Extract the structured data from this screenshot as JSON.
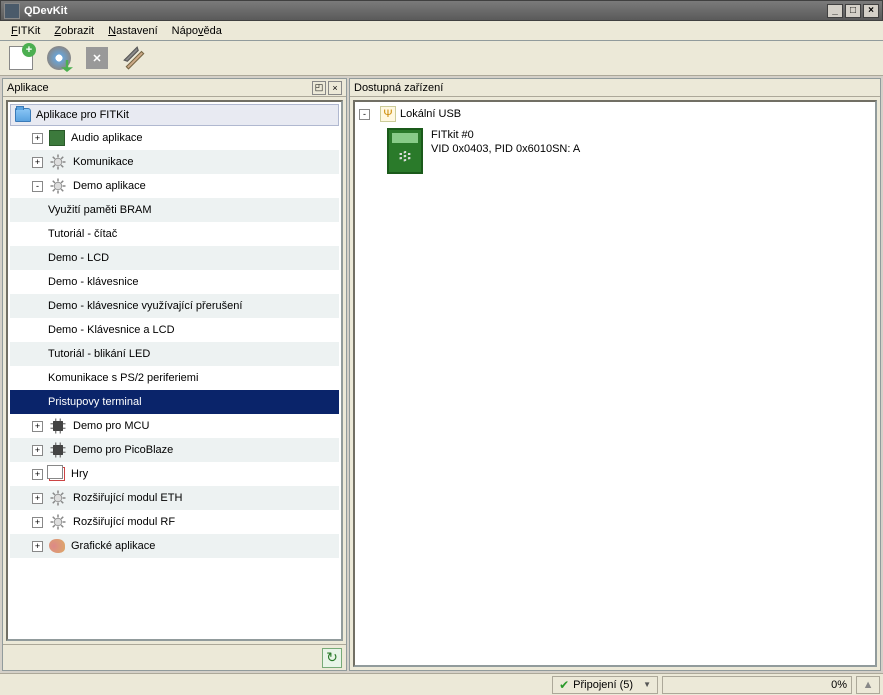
{
  "window": {
    "title": "QDevKit"
  },
  "menu": {
    "items": [
      "FITKit",
      "Zobrazit",
      "Nastavení",
      "Nápověda"
    ]
  },
  "left_panel": {
    "title": "Aplikace",
    "root": "Aplikace pro FITKit",
    "tree": [
      {
        "label": "Audio aplikace",
        "icon": "app",
        "exp": "+",
        "level": 1,
        "striped": false
      },
      {
        "label": "Komunikace",
        "icon": "gear",
        "exp": "+",
        "level": 1,
        "striped": true
      },
      {
        "label": "Demo aplikace",
        "icon": "gear",
        "exp": "-",
        "level": 1,
        "striped": false
      },
      {
        "label": "Využití paměti BRAM",
        "level": 2,
        "striped": true
      },
      {
        "label": "Tutoriál - čítač",
        "level": 2,
        "striped": false
      },
      {
        "label": "Demo - LCD",
        "level": 2,
        "striped": true
      },
      {
        "label": "Demo - klávesnice",
        "level": 2,
        "striped": false
      },
      {
        "label": "Demo - klávesnice využívající přerušení",
        "level": 2,
        "striped": true
      },
      {
        "label": "Demo - Klávesnice a LCD",
        "level": 2,
        "striped": false
      },
      {
        "label": "Tutoriál - blikání LED",
        "level": 2,
        "striped": true
      },
      {
        "label": "Komunikace s PS/2 periferiemi",
        "level": 2,
        "striped": false
      },
      {
        "label": "Pristupovy terminal",
        "level": 2,
        "selected": true
      },
      {
        "label": "Demo pro MCU",
        "icon": "chip",
        "exp": "+",
        "level": 1,
        "striped": false
      },
      {
        "label": "Demo pro PicoBlaze",
        "icon": "chip",
        "exp": "+",
        "level": 1,
        "striped": true
      },
      {
        "label": "Hry",
        "icon": "cards",
        "exp": "+",
        "level": 1,
        "striped": false
      },
      {
        "label": "Rozšiřující modul ETH",
        "icon": "gear",
        "exp": "+",
        "level": 1,
        "striped": true
      },
      {
        "label": "Rozšiřující modul RF",
        "icon": "gear",
        "exp": "+",
        "level": 1,
        "striped": false
      },
      {
        "label": "Grafické aplikace",
        "icon": "palette",
        "exp": "+",
        "level": 1,
        "striped": true
      }
    ]
  },
  "right_panel": {
    "title": "Dostupná zařízení",
    "root": "Lokální USB",
    "device": {
      "name": "FITkit #0",
      "detail": "VID 0x0403, PID 0x6010SN: A"
    }
  },
  "status": {
    "conn_label": "Připojení (5)",
    "progress": "0%"
  }
}
